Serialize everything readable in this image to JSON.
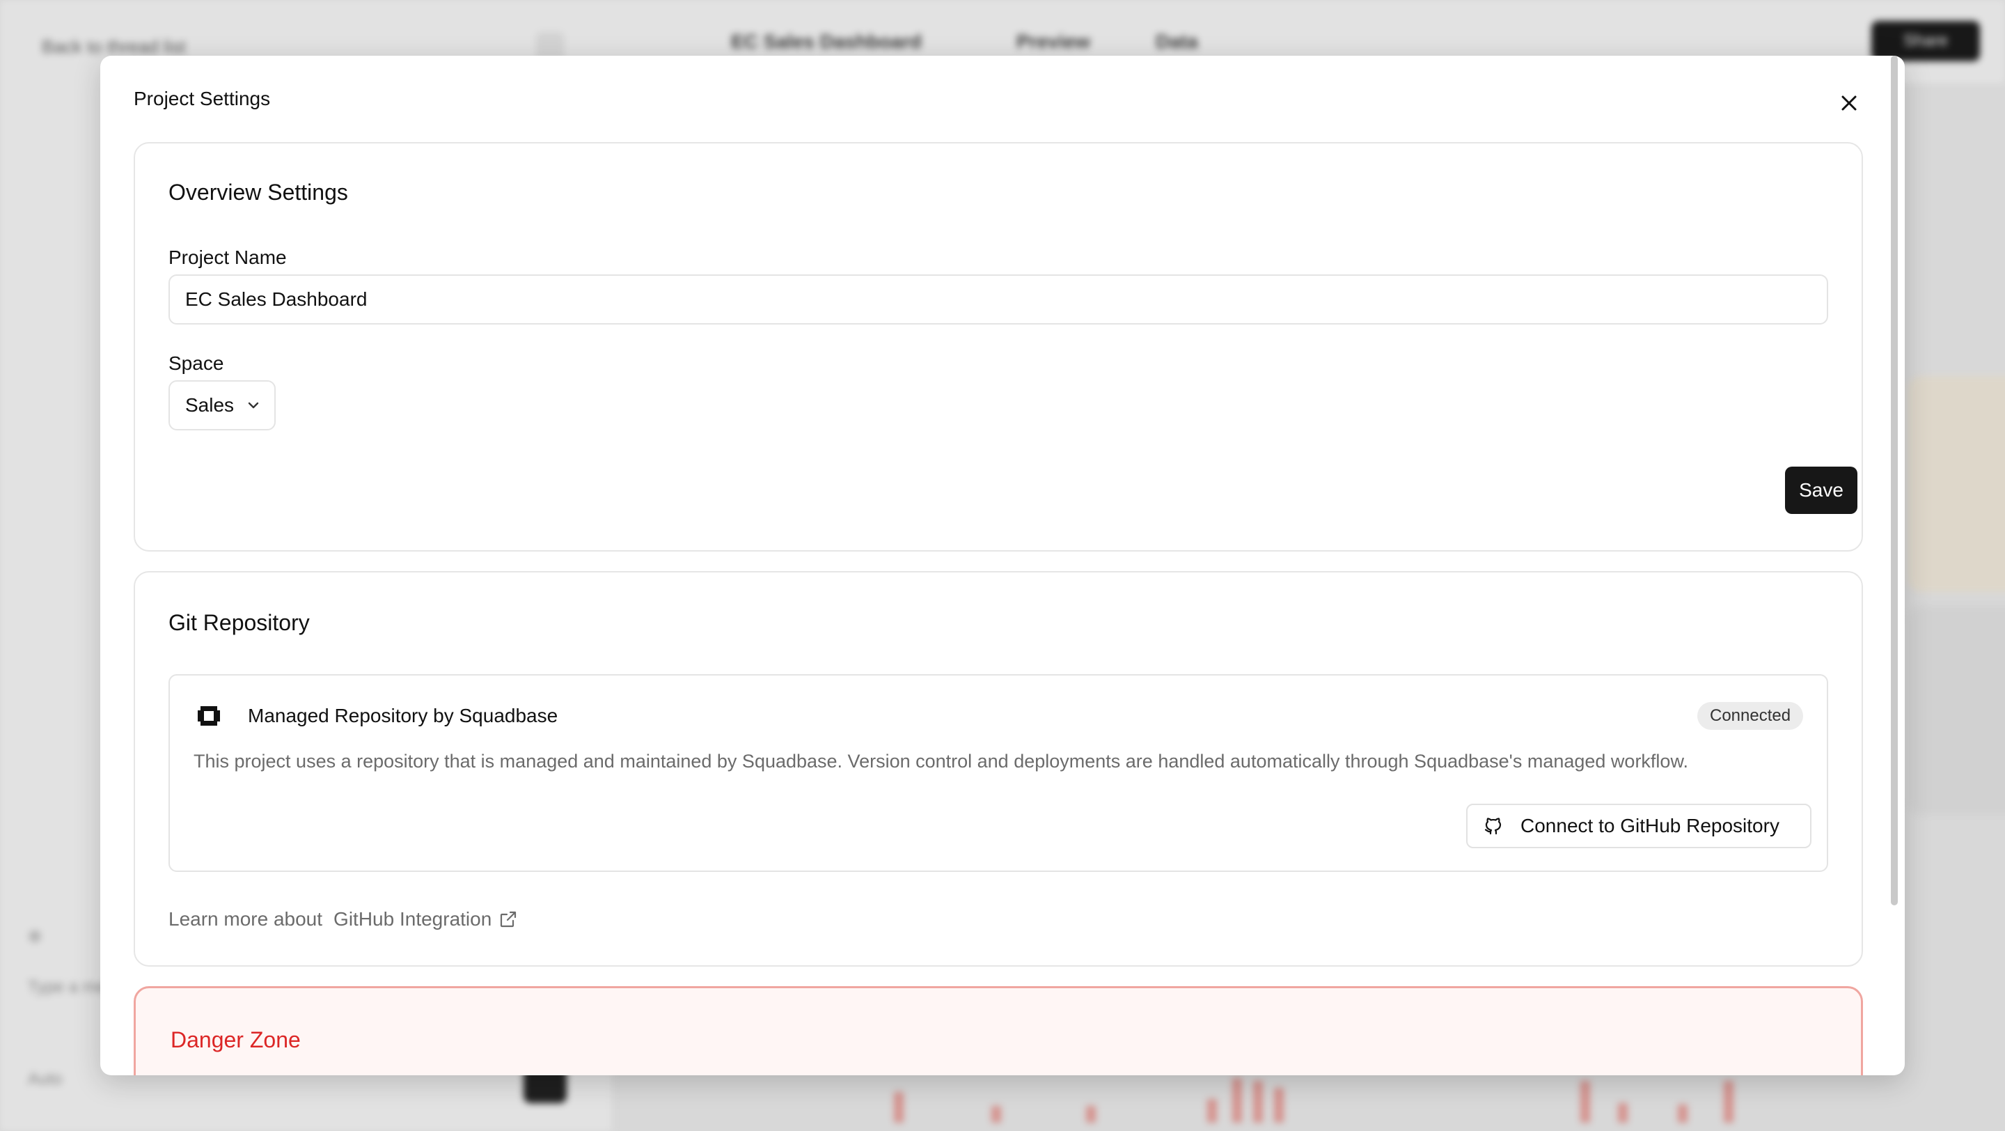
{
  "background": {
    "back_link": "Back to thread list",
    "project_title": "EC Sales Dashboard",
    "preview_tab": "Preview",
    "data_tab": "Data",
    "share_button": "Share",
    "chat_placeholder": "Type a message",
    "chat_mode": "Auto"
  },
  "modal": {
    "title": "Project Settings",
    "close_icon": "close-icon"
  },
  "overview": {
    "title": "Overview Settings",
    "project_name_label": "Project Name",
    "project_name_value": "EC Sales Dashboard",
    "space_label": "Space",
    "space_value": "Sales",
    "save_label": "Save"
  },
  "git": {
    "title": "Git Repository",
    "repo_name": "Managed Repository by Squadbase",
    "status_badge": "Connected",
    "description": "This project uses a repository that is managed and maintained by Squadbase. Version control and deployments are handled automatically through Squadbase's managed workflow.",
    "connect_button": "Connect to GitHub Repository",
    "learn_prefix": "Learn more about",
    "learn_link": "GitHub Integration"
  },
  "danger": {
    "title": "Danger Zone"
  },
  "colors": {
    "danger": "#dc2626",
    "danger_bg": "#fff6f5",
    "primary_button": "#171717"
  }
}
